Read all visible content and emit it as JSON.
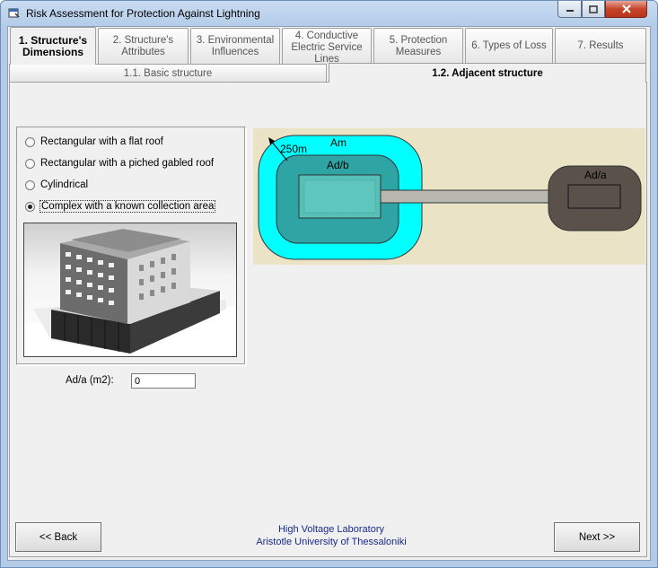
{
  "window": {
    "title": "Risk Assessment for Protection Against Lightning",
    "app_icon": "app-window-icon",
    "controls": {
      "minimize_icon": "minimize-icon",
      "maximize_icon": "maximize-icon",
      "close_icon": "close-icon"
    }
  },
  "tabs": [
    {
      "line1": "1. Structure's",
      "line2": "Dimensions",
      "line3": ""
    },
    {
      "line1": "2. Structure's",
      "line2": "Attributes",
      "line3": ""
    },
    {
      "line1": "3. Environmental",
      "line2": "Influences",
      "line3": ""
    },
    {
      "line1": "4. Conductive",
      "line2": "Electric Service",
      "line3": "Lines"
    },
    {
      "line1": "5. Protection",
      "line2": "Measures",
      "line3": ""
    },
    {
      "line1": "6. Types of Loss",
      "line2": "",
      "line3": ""
    },
    {
      "line1": "7. Results",
      "line2": "",
      "line3": ""
    }
  ],
  "subtabs": [
    "1.1. Basic structure",
    "1.2. Adjacent structure"
  ],
  "shape_options": [
    {
      "label": "Rectangular with a flat roof",
      "checked": false
    },
    {
      "label": "Rectangular with a piched gabled roof",
      "checked": false
    },
    {
      "label": "Cylindrical",
      "checked": false
    },
    {
      "label": "Complex with a known collection area",
      "checked": true
    }
  ],
  "area_field": {
    "label": "Ad/a (m2):",
    "value": "0"
  },
  "diagram": {
    "radius_label": "250m",
    "am_label": "Am",
    "adb_label": "Ad/b",
    "ada_label": "Ad/a"
  },
  "buttons": {
    "back": "<< Back",
    "next": "Next >>"
  },
  "footer": {
    "line1": "High Voltage Laboratory",
    "line2": "Aristotle University of Thessaloniki"
  }
}
